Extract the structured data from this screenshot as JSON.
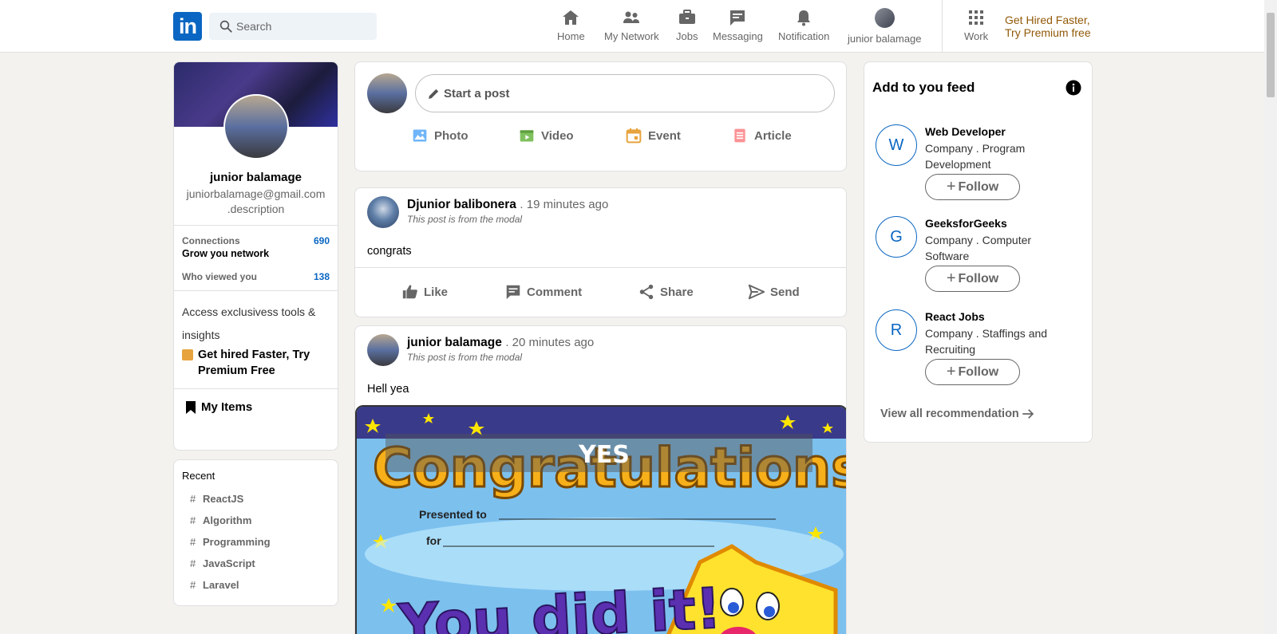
{
  "header": {
    "logo_text": "in",
    "search_placeholder": "Search",
    "nav": [
      {
        "label": "Home",
        "icon": "home-icon"
      },
      {
        "label": "My Network",
        "icon": "network-icon"
      },
      {
        "label": "Jobs",
        "icon": "briefcase-icon"
      },
      {
        "label": "Messaging",
        "icon": "message-icon"
      },
      {
        "label": "Notification",
        "icon": "bell-icon"
      },
      {
        "label": "junior balamage",
        "icon": "avatar"
      },
      {
        "label": "Work",
        "icon": "grid-icon"
      }
    ],
    "premium_line1": "Get Hired Faster,",
    "premium_line2": "Try Premium free"
  },
  "profile": {
    "name": "junior balamage",
    "email": "juniorbalamage@gmail.com",
    "description": ".description",
    "connections_label": "Connections",
    "connections_value": "690",
    "grow_label": "Grow you network",
    "viewed_label": "Who viewed you",
    "viewed_value": "138",
    "access_text": "Access exclusivess tools & insights",
    "premium_text": "Get hired Faster, Try Premium Free",
    "my_items": "My Items"
  },
  "recent": {
    "title": "Recent",
    "items": [
      "ReactJS",
      "Algorithm",
      "Programming",
      "JavaScript",
      "Laravel"
    ]
  },
  "share": {
    "placeholder": "Start a post",
    "actions": [
      {
        "label": "Photo",
        "color": "#70b5f9"
      },
      {
        "label": "Video",
        "color": "#7fc15e"
      },
      {
        "label": "Event",
        "color": "#e7a33e"
      },
      {
        "label": "Article",
        "color": "#fc9295"
      }
    ]
  },
  "posts": [
    {
      "author": "Djunior balibonera",
      "time": ". 19 minutes ago",
      "subtitle": "This post is from the modal",
      "text": "congrats"
    },
    {
      "author": "junior balamage",
      "time": ". 20 minutes ago",
      "subtitle": "This post is from the modal",
      "text": "Hell yea",
      "image_text": {
        "headline": "Congratulations",
        "overlay": "YES",
        "presented": "Presented to",
        "for": "for",
        "big": "You did it!"
      }
    }
  ],
  "post_actions": [
    "Like",
    "Comment",
    "Share",
    "Send"
  ],
  "feed": {
    "title": "Add to you feed",
    "items": [
      {
        "initial": "W",
        "name": "Web Developer",
        "desc": "Company . Program Development"
      },
      {
        "initial": "G",
        "name": "GeeksforGeeks",
        "desc": "Company . Computer Software"
      },
      {
        "initial": "R",
        "name": "React Jobs",
        "desc": "Company . Staffings and Recruiting"
      }
    ],
    "follow_label": "Follow",
    "view_all": "View all recommendation"
  }
}
